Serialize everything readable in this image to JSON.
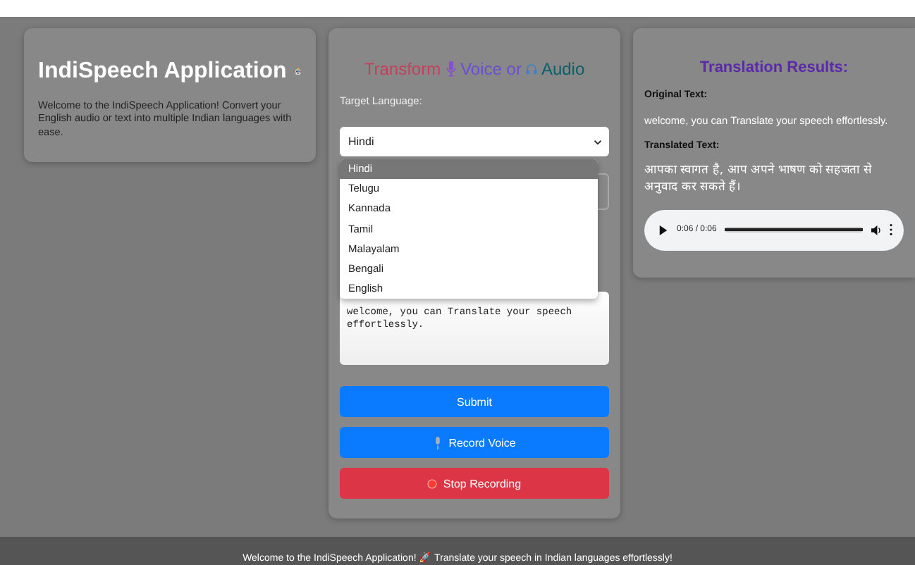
{
  "intro": {
    "title": "IndiSpeech Application",
    "description": "Welcome to the IndiSpeech Application! Convert your English audio or text into multiple Indian languages with ease."
  },
  "form": {
    "heading": [
      {
        "text": "Transform",
        "color": "#c4415e"
      },
      {
        "text": "Voice or",
        "color": "#6a4fd0"
      },
      {
        "text": "Audio",
        "color": "#0b5f6a"
      }
    ],
    "target_label": "Target Language:",
    "select_value": "Hindi",
    "options": [
      {
        "label": "Hindi",
        "selected": true
      },
      {
        "label": "Telugu",
        "selected": false
      },
      {
        "label": "Kannada",
        "selected": false
      },
      {
        "label": "Tamil",
        "selected": false
      },
      {
        "label": "Malayalam",
        "selected": false
      },
      {
        "label": "Bengali",
        "selected": false
      },
      {
        "label": "English",
        "selected": false
      }
    ],
    "text_value": "welcome, you can Translate your speech effortlessly.",
    "buttons": [
      {
        "label": "Submit",
        "kind": "submit"
      },
      {
        "label": "Record Voice",
        "kind": "record"
      },
      {
        "label": "Stop Recording",
        "kind": "stop"
      }
    ]
  },
  "results": {
    "title": "Translation Results:",
    "original_label": "Original Text:",
    "original_text": "welcome, you can Translate your speech effortlessly.",
    "translated_label": "Translated Text:",
    "translated_text": "आपका स्वागत है, आप अपने भाषण को सहजता से अनुवाद कर सकते हैं।",
    "audio": {
      "time": "0:06 / 0:06",
      "level": 1
    }
  },
  "footer": {
    "text": "Welcome to the IndiSpeech Application! 🚀 Translate your speech in Indian languages effortlessly!"
  }
}
